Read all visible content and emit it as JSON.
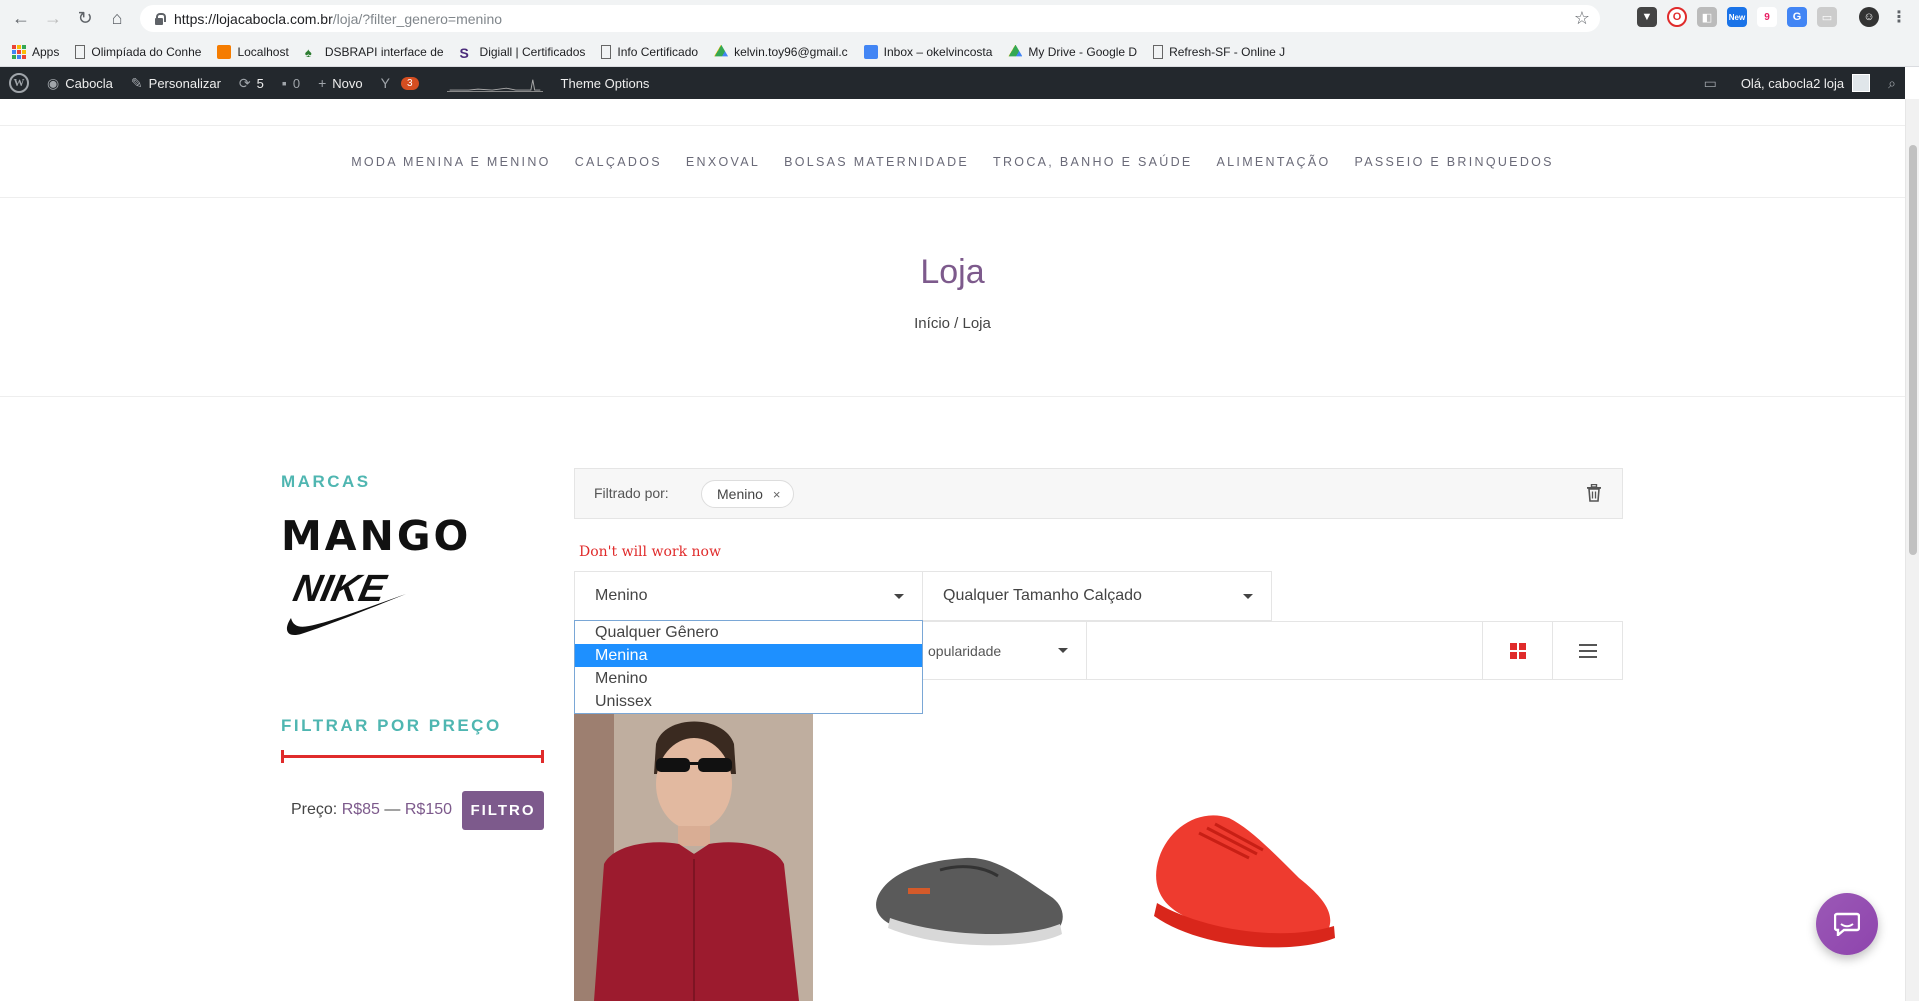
{
  "browser": {
    "url_host": "https://lojacabocla.com.br",
    "url_path": "/loja/?filter_genero=menino",
    "ext_badges": {
      "new": "New",
      "count": "9"
    },
    "bookmarks": [
      {
        "label": "Apps",
        "icon": "apps-grid-icon"
      },
      {
        "label": "Olimpíada do Conhe",
        "icon": "page-icon"
      },
      {
        "label": "Localhost",
        "icon": "xampp-icon"
      },
      {
        "label": "DSBRAPI interface de",
        "icon": "leaf-icon"
      },
      {
        "label": "Digiall | Certificados",
        "icon": "s-logo-icon"
      },
      {
        "label": "Info Certificado",
        "icon": "page-icon"
      },
      {
        "label": "kelvin.toy96@gmail.c",
        "icon": "drive-icon"
      },
      {
        "label": "Inbox – okelvincosta",
        "icon": "inbox-icon"
      },
      {
        "label": "My Drive - Google D",
        "icon": "drive-icon"
      },
      {
        "label": "Refresh-SF - Online J",
        "icon": "page-icon"
      }
    ]
  },
  "wpbar": {
    "site": "Cabocla",
    "customize": "Personalizar",
    "updates": "5",
    "comments": "0",
    "new": "Novo",
    "yoast_count": "3",
    "theme_options": "Theme Options",
    "greeting": "Olá, cabocla2 loja"
  },
  "nav": {
    "items": [
      "MODA MENINA E MENINO",
      "CALÇADOS",
      "ENXOVAL",
      "BOLSAS MATERNIDADE",
      "TROCA, BANHO E SAÚDE",
      "ALIMENTAÇÃO",
      "PASSEIO E BRINQUEDOS"
    ]
  },
  "page": {
    "title": "Loja",
    "breadcrumb": "Início / Loja"
  },
  "sidebar": {
    "brands_heading": "MARCAS",
    "brand_mango": "MANGO",
    "brand_nike": "NIKE",
    "price_heading": "FILTRAR POR PREÇO",
    "price_prefix": "Preço:",
    "price_min": "R$85",
    "price_sep": "—",
    "price_max": "R$150",
    "filter_button": "FILTRO"
  },
  "filters": {
    "filtered_by": "Filtrado por:",
    "chip": "Menino",
    "chip_remove": "×",
    "warning": "Don't will work now",
    "genero_selected": "Menino",
    "tamanho_selected": "Qualquer Tamanho Calçado",
    "sort_selected": "opularidade",
    "genero_options": [
      {
        "label": "Qualquer Gênero",
        "active": false
      },
      {
        "label": "Menina",
        "active": true
      },
      {
        "label": "Menino",
        "active": false
      },
      {
        "label": "Unissex",
        "active": false
      }
    ]
  },
  "colors": {
    "accent_purple": "#7d5a8c",
    "teal_heading": "#4fb6b1",
    "red": "#e02b2b",
    "dropdown_active": "#1e90ff"
  }
}
